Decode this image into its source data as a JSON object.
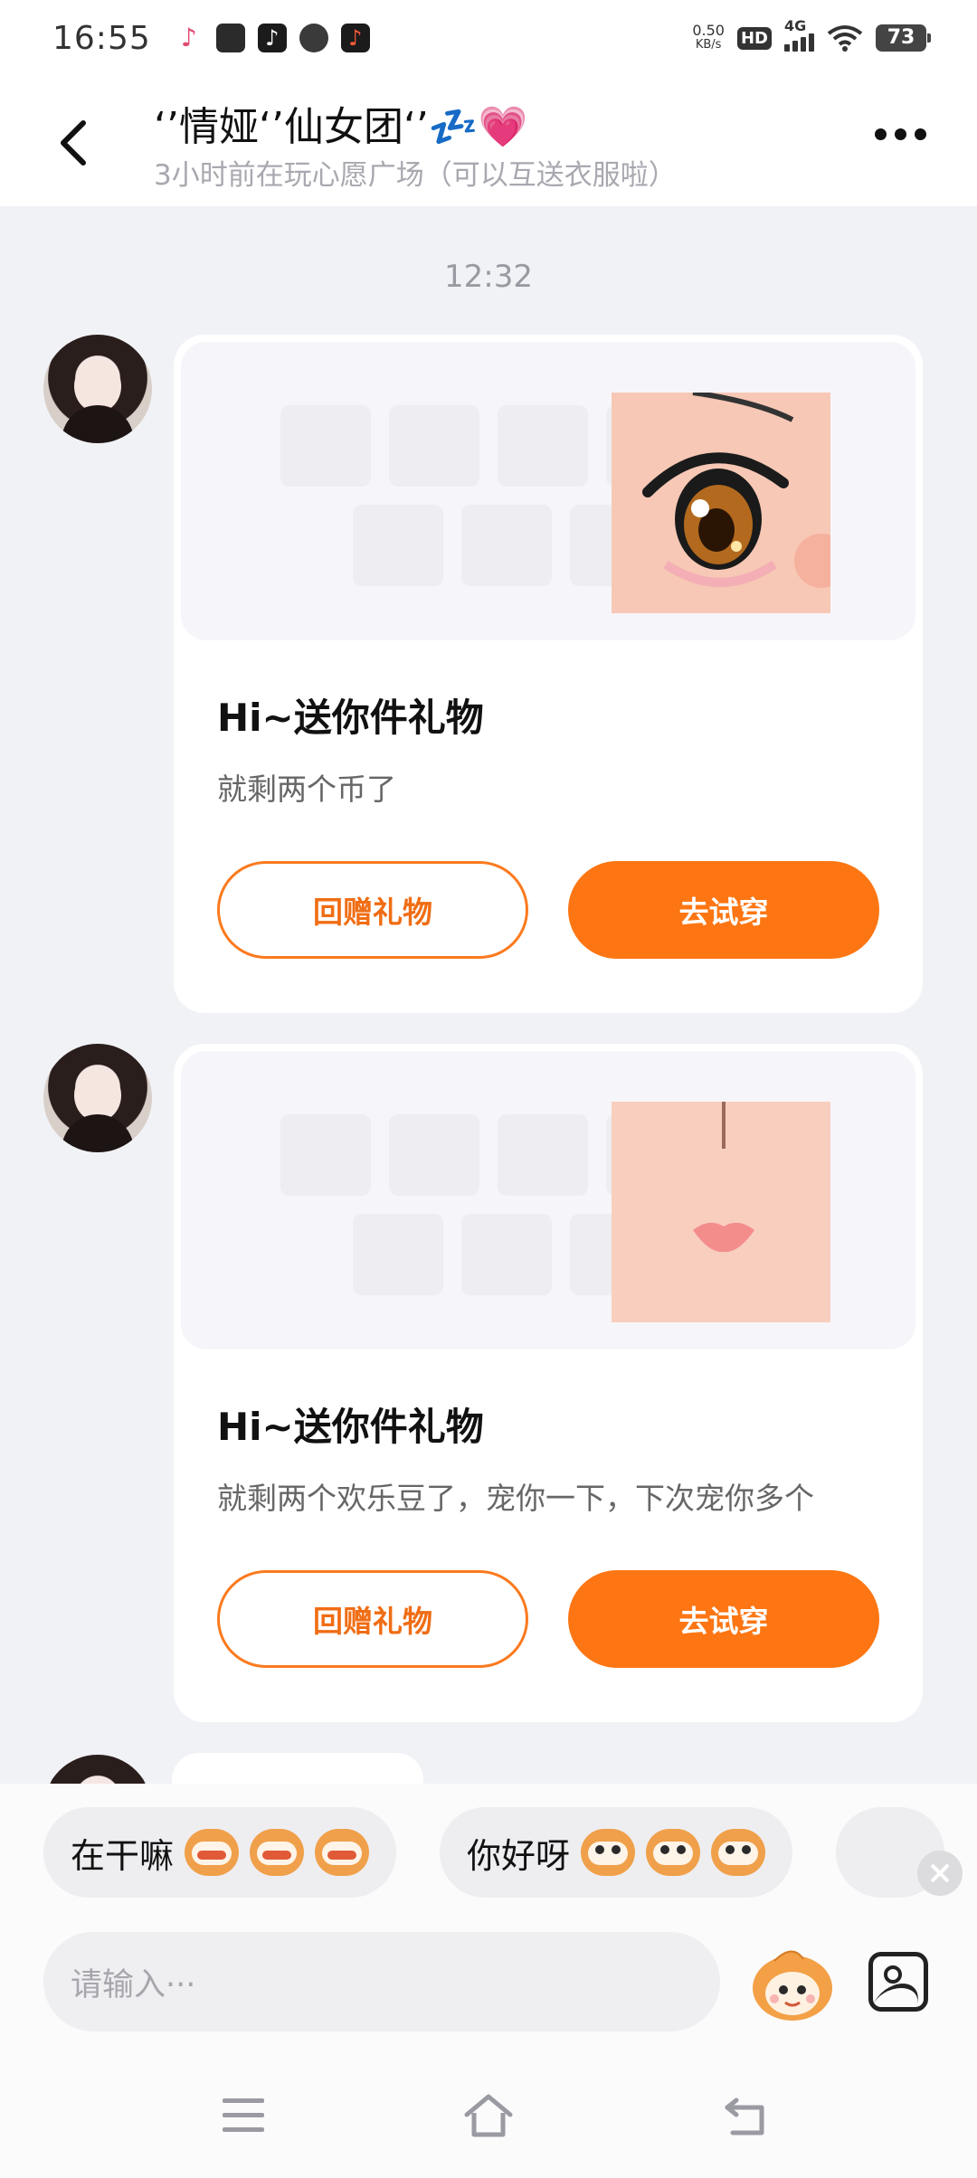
{
  "status_bar": {
    "time": "16:55",
    "net_speed_value": "0.50",
    "net_speed_unit": "KB/s",
    "hd_label": "HD",
    "network_label": "4G",
    "battery": "73"
  },
  "header": {
    "title": "‘’情娅‘’仙女团‘’💤💗",
    "subtitle": "3小时前在玩心愿广场（可以互送衣服啦）"
  },
  "chat": {
    "timestamp": "12:32",
    "messages": [
      {
        "image_icon": "anime-eye-item",
        "title": "Hi~送你件礼物",
        "text": "就剩两个币了",
        "return_label": "回赠礼物",
        "try_label": "去试穿"
      },
      {
        "image_icon": "lips-item",
        "title": "Hi~送你件礼物",
        "text": "就剩两个欢乐豆了，宠你一下，下次宠你多个",
        "return_label": "回赠礼物",
        "try_label": "去试穿"
      }
    ]
  },
  "quick_replies": [
    {
      "text": "在干嘛",
      "emoji_icon": "grinning-monkey-emoji"
    },
    {
      "text": "你好呀",
      "emoji_icon": "surprised-monkey-emoji"
    }
  ],
  "input": {
    "placeholder": "请输入···"
  },
  "colors": {
    "accent": "#fd7613",
    "background": "#f1f2f6"
  }
}
